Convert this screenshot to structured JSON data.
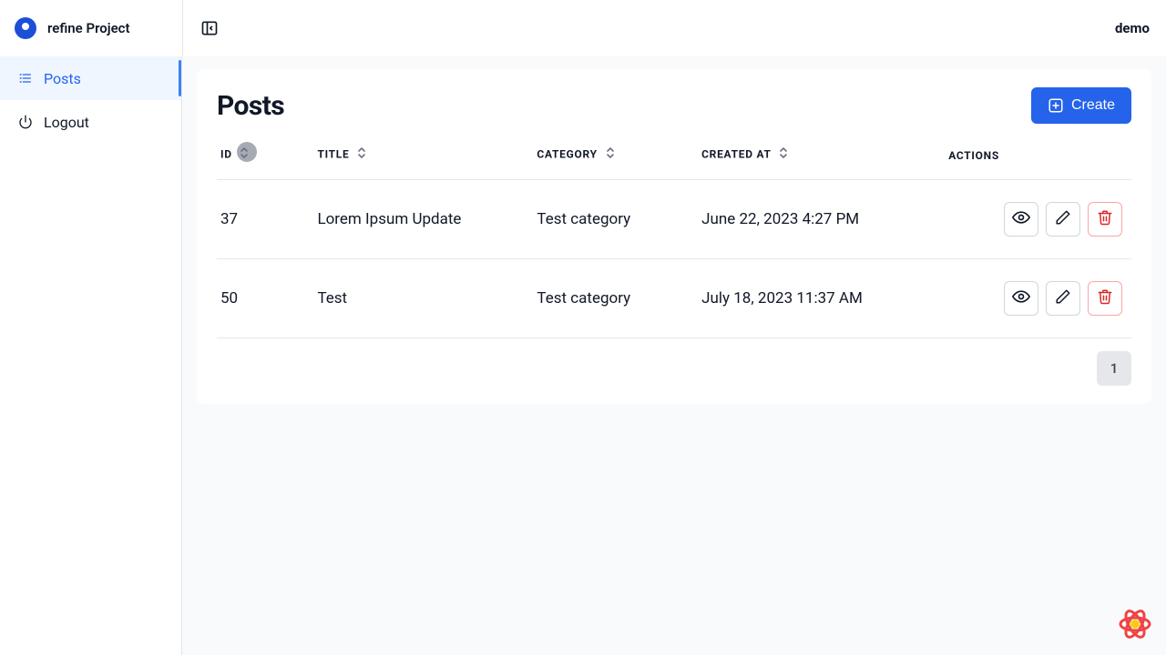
{
  "header": {
    "appTitle": "refine Project",
    "user": "demo"
  },
  "sidebar": {
    "items": [
      {
        "label": "Posts",
        "active": true
      },
      {
        "label": "Logout",
        "active": false
      }
    ]
  },
  "page": {
    "title": "Posts",
    "createLabel": "Create",
    "columns": {
      "id": "ID",
      "title": "TITLE",
      "category": "CATEGORY",
      "createdAt": "CREATED AT",
      "actions": "ACTIONS"
    },
    "rows": [
      {
        "id": "37",
        "title": "Lorem Ipsum Update",
        "category": "Test category",
        "createdAt": "June 22, 2023 4:27 PM"
      },
      {
        "id": "50",
        "title": "Test",
        "category": "Test category",
        "createdAt": "July 18, 2023 11:37 AM"
      }
    ],
    "pagination": {
      "current": "1"
    }
  },
  "icons": {
    "collapse": "collapse-sidebar-icon",
    "list": "list-icon",
    "power": "power-icon",
    "plus": "plus-square-icon",
    "sort": "sort-icon",
    "eye": "eye-icon",
    "pencil": "pencil-icon",
    "trash": "trash-icon",
    "react": "react-query-devtools-icon"
  },
  "colors": {
    "primary": "#2563eb",
    "danger": "#dc2626",
    "border": "#e5e7eb",
    "mainBg": "#f8fafc"
  }
}
